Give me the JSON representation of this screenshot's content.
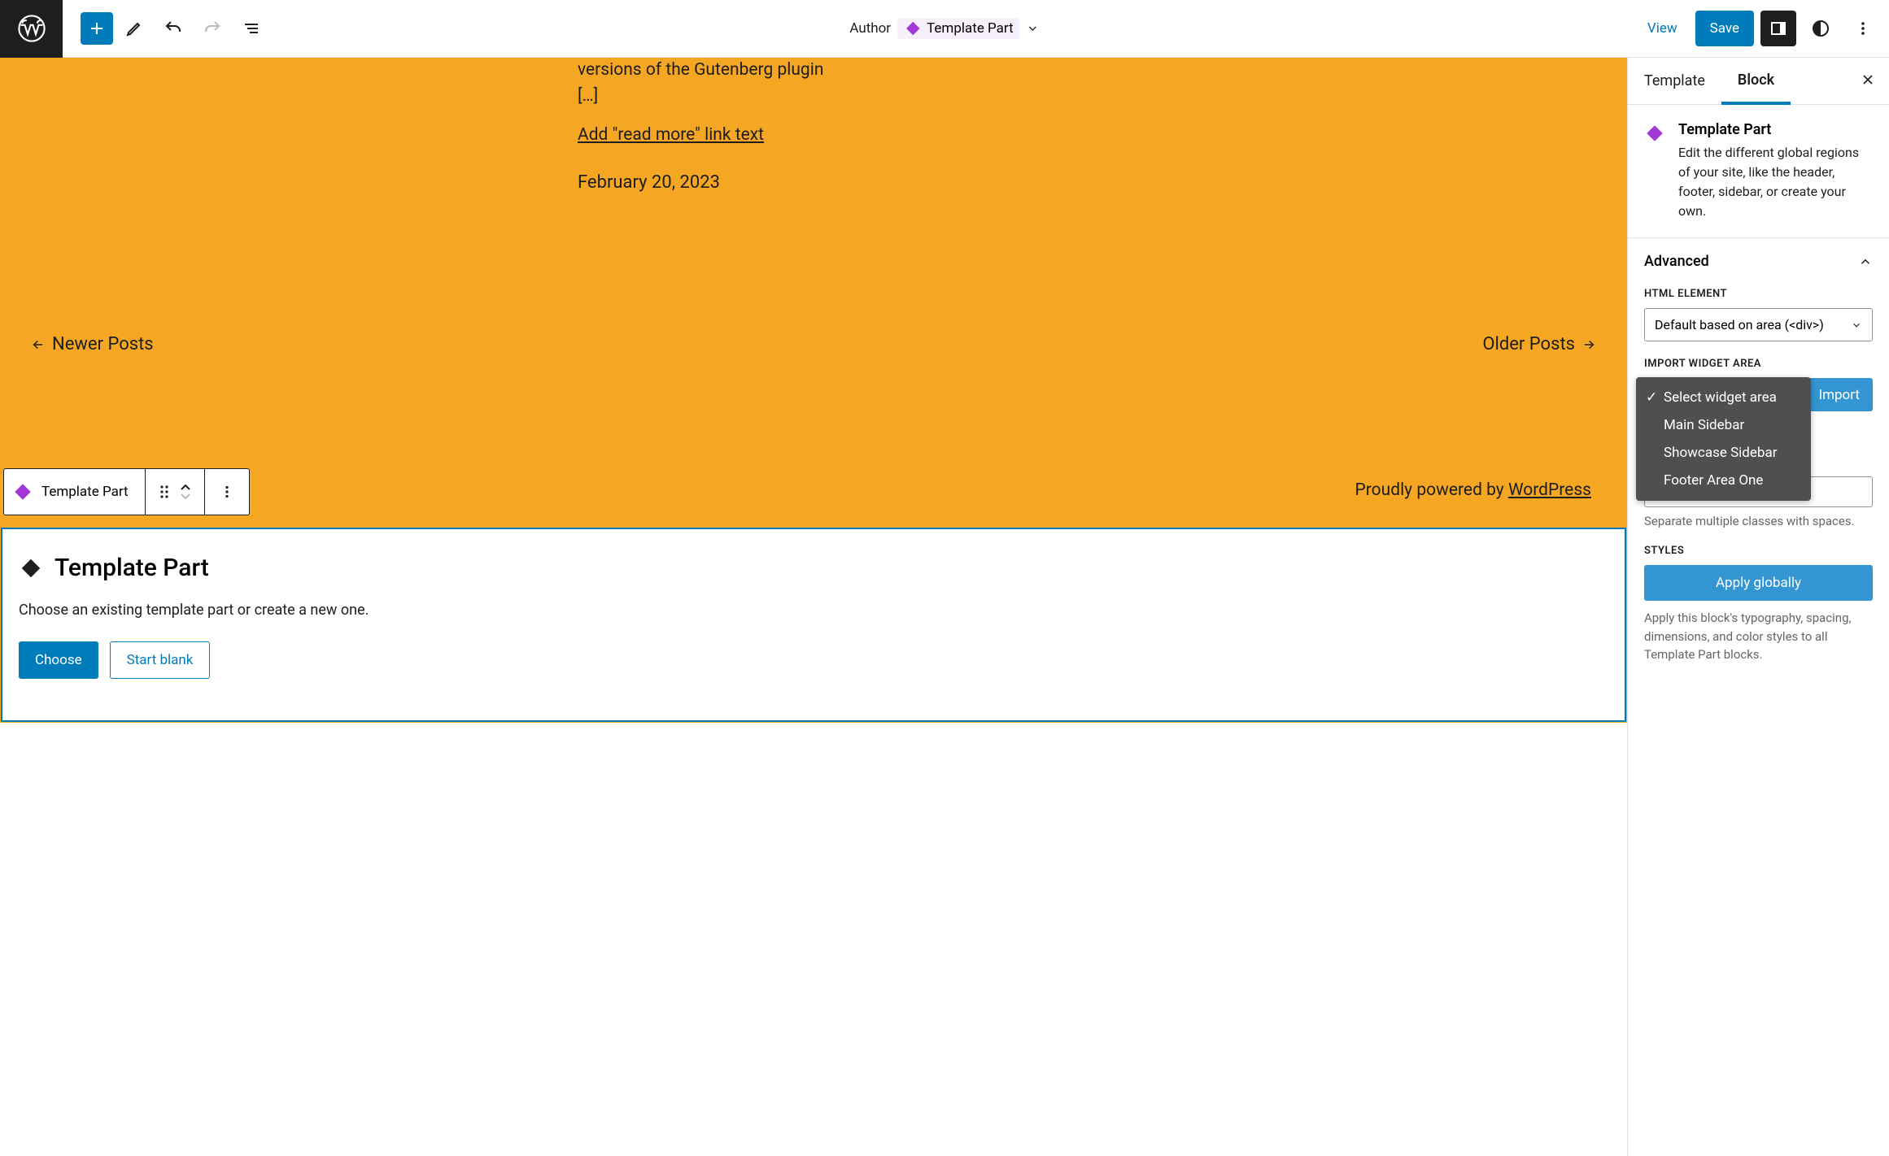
{
  "toolbar": {
    "author_label": "Author",
    "template_part_label": "Template Part",
    "view_label": "View",
    "save_label": "Save"
  },
  "canvas": {
    "excerpt": "versions of the Gutenberg plugin […]",
    "read_more": "Add \"read more\" link text",
    "post_date": "February 20, 2023",
    "newer_posts": "Newer Posts",
    "older_posts": "Older Posts",
    "footer_prefix": "Proudly powered by ",
    "footer_link": "WordPress",
    "block_toolbar_label": "Template Part",
    "placeholder": {
      "title": "Template Part",
      "desc": "Choose an existing template part or create a new one.",
      "choose": "Choose",
      "start_blank": "Start blank"
    }
  },
  "sidebar": {
    "tabs": {
      "template": "Template",
      "block": "Block"
    },
    "block_header": {
      "title": "Template Part",
      "desc": "Edit the different global regions of your site, like the header, footer, sidebar, or create your own."
    },
    "advanced": {
      "title": "Advanced",
      "html_element_label": "HTML ELEMENT",
      "html_element_value": "Default based on area (<div>)",
      "import_label": "IMPORT WIDGET AREA",
      "import_button": "Import",
      "dropdown": {
        "select": "Select widget area",
        "main": "Main Sidebar",
        "showcase": "Showcase Sidebar",
        "footer": "Footer Area One"
      },
      "css_help": "Separate multiple classes with spaces.",
      "styles_label": "STYLES",
      "apply_globally": "Apply globally",
      "apply_desc": "Apply this block's typography, spacing, dimensions, and color styles to all Template Part blocks."
    }
  }
}
